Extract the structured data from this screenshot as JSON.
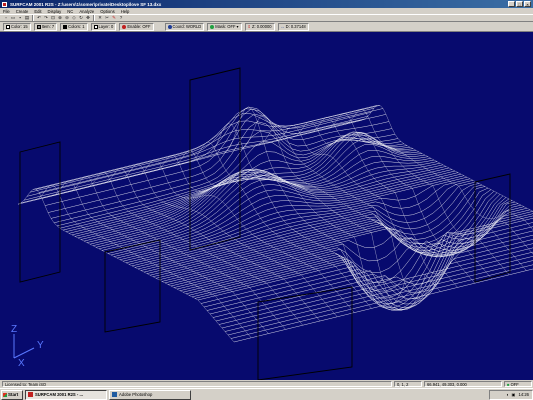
{
  "window": {
    "title": "SURFCAM 2001 R2S - Z:\\users\\1\\somer\\private\\Desktop\\love SF 13.dxx",
    "min_label": "_",
    "max_label": "□",
    "close_label": "×"
  },
  "menu": [
    "File",
    "Create",
    "Edit",
    "Display",
    "NC",
    "Analyze",
    "Options",
    "Help"
  ],
  "toolbar_icons": [
    "new-file-icon",
    "open-file-icon",
    "save-icon",
    "print-icon",
    "undo-icon",
    "redo-icon",
    "zoom-window-icon",
    "zoom-in-icon",
    "zoom-out-icon",
    "zoom-fit-icon",
    "rotate-icon",
    "pan-icon",
    "delete-icon",
    "cut-icon",
    "edit-icon",
    "help-icon"
  ],
  "attributes": {
    "color": "Color: 15",
    "item": "Item: 7",
    "colors": "Colors: 1",
    "layer": "Layer: 0",
    "enable": "Enable: OFF",
    "coord": "Coord: WORLD",
    "mask": "Mask: OFF",
    "z": "Z: 0.00000",
    "depth": "D: 0.37148"
  },
  "colors": {
    "title_start": "#0a246a",
    "viewport_bg": "#070a6e",
    "mesh": "#ffffff",
    "axis": "#5a78ff",
    "frame": "#000000"
  },
  "axes": {
    "z": "Z",
    "y": "Y",
    "x": "X"
  },
  "status": {
    "left": "Licensed to: Team iSO",
    "view": "0, 1, 2",
    "coords": "66.941, 49.303, 0.000",
    "snap": "OFF"
  },
  "taskbar": {
    "start": "Start",
    "tasks": [
      "SURFCAM 2001 R2S - ...",
      "Adobe Photoshop"
    ],
    "clock": "14:26"
  }
}
